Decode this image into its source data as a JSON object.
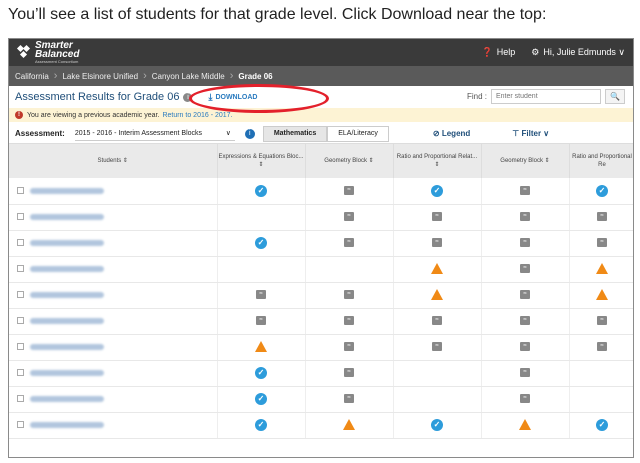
{
  "caption": "You’ll see a list of students for that grade level.  Click Download near the top:",
  "app": {
    "logo_line1": "Smarter",
    "logo_line2": "Balanced",
    "logo_sub": "Assessment Consortium",
    "help": "Help",
    "user": "Hi, Julie Edmunds"
  },
  "breadcrumb": [
    "California",
    "Lake Elsinore Unified",
    "Canyon Lake Middle",
    "Grade 06"
  ],
  "header": {
    "title": "Assessment Results for Grade 06",
    "download": "DOWNLOAD",
    "find_label": "Find :",
    "find_placeholder": "Enter student"
  },
  "notice": {
    "text": "You are viewing a previous academic year.",
    "link": "Return to 2016 - 2017."
  },
  "assessment": {
    "label": "Assessment:",
    "selected": "2015 - 2016 - Interim Assessment Blocks",
    "tabs": [
      "Mathematics",
      "ELA/Literacy"
    ],
    "legend": "Legend",
    "filter": "Filter"
  },
  "columns": [
    "Students",
    "Expressions & Equations Bloc...",
    "Geometry Block",
    "Ratio and Proportional Relat...",
    "Geometry Block",
    "Ratio and Proportional Re"
  ],
  "rows": [
    [
      "check",
      "none",
      "check",
      "none",
      "check"
    ],
    [
      "",
      "none",
      "none",
      "none",
      "none"
    ],
    [
      "check",
      "none",
      "none",
      "none",
      "none"
    ],
    [
      "",
      "",
      "warn",
      "none",
      "warn"
    ],
    [
      "none",
      "none",
      "warn",
      "none",
      "warn"
    ],
    [
      "none",
      "none",
      "none",
      "none",
      "none"
    ],
    [
      "warn",
      "none",
      "none",
      "none",
      "none"
    ],
    [
      "check",
      "none",
      "",
      "none",
      ""
    ],
    [
      "check",
      "none",
      "",
      "none",
      ""
    ],
    [
      "check",
      "warn",
      "check",
      "warn",
      "check"
    ]
  ],
  "colors": {
    "accent": "#2a7bbf",
    "check": "#2d9cdb",
    "warn": "#f08a16",
    "highlight": "#e3202b"
  }
}
